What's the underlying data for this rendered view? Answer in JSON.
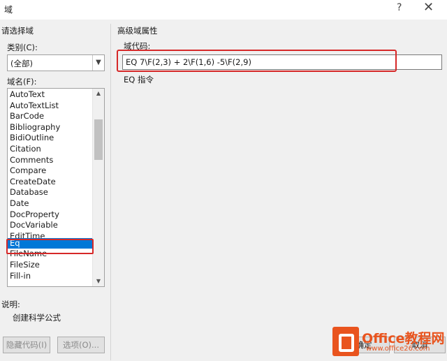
{
  "window": {
    "title": "域",
    "help_label": "?",
    "close_label": "✕"
  },
  "left": {
    "group_title": "请选择域",
    "category_label": "类别(C):",
    "category_value": "(全部)",
    "field_names_label": "域名(F):",
    "field_names": [
      "AutoText",
      "AutoTextList",
      "BarCode",
      "Bibliography",
      "BidiOutline",
      "Citation",
      "Comments",
      "Compare",
      "CreateDate",
      "Database",
      "Date",
      "DocProperty",
      "DocVariable",
      "EditTime",
      "Eq",
      "FileName",
      "FileSize",
      "Fill-in"
    ],
    "selected_field": "Eq",
    "description_label": "说明:",
    "description_text": "创建科学公式",
    "hide_codes_button": "隐藏代码(I)",
    "options_button": "选项(O)..."
  },
  "right": {
    "group_title": "高级域属性",
    "field_codes_label": "域代码:",
    "field_codes_value": "EQ 7\\F(2,3) + 2\\F(1,6) -5\\F(2,9)",
    "hint": "EQ 指令",
    "ok_button": "确定",
    "cancel_button": "取消"
  },
  "watermark": {
    "brand": "Office教程网",
    "url": "www.office26.com"
  },
  "colors": {
    "selection": "#0078d7",
    "highlight": "#d62828",
    "brand": "#e9541e"
  }
}
